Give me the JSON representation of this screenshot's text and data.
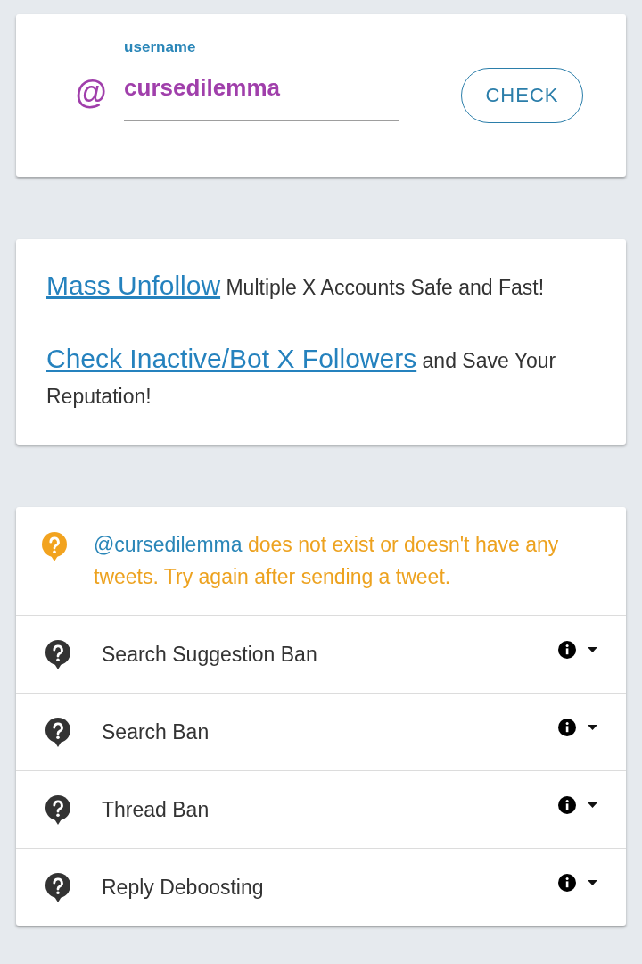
{
  "lookup_form": {
    "prefix": "@",
    "label": "username",
    "value": "cursedilemma",
    "button": "CHECK"
  },
  "promos": [
    {
      "link": "Mass Unfollow",
      "text": "Multiple X Accounts Safe and Fast!"
    },
    {
      "link": "Check Inactive/Bot X Followers",
      "text": "and Save Your Reputation!"
    }
  ],
  "result": {
    "handle": "@cursedilemma",
    "message": "does not exist or doesn't have any tweets. Try again after sending a tweet."
  },
  "checks": [
    {
      "name": "Search Suggestion Ban",
      "expanded": false
    },
    {
      "name": "Search Ban",
      "expanded": false
    },
    {
      "name": "Thread Ban",
      "expanded": false
    },
    {
      "name": "Reply Deboosting",
      "expanded": false
    }
  ]
}
